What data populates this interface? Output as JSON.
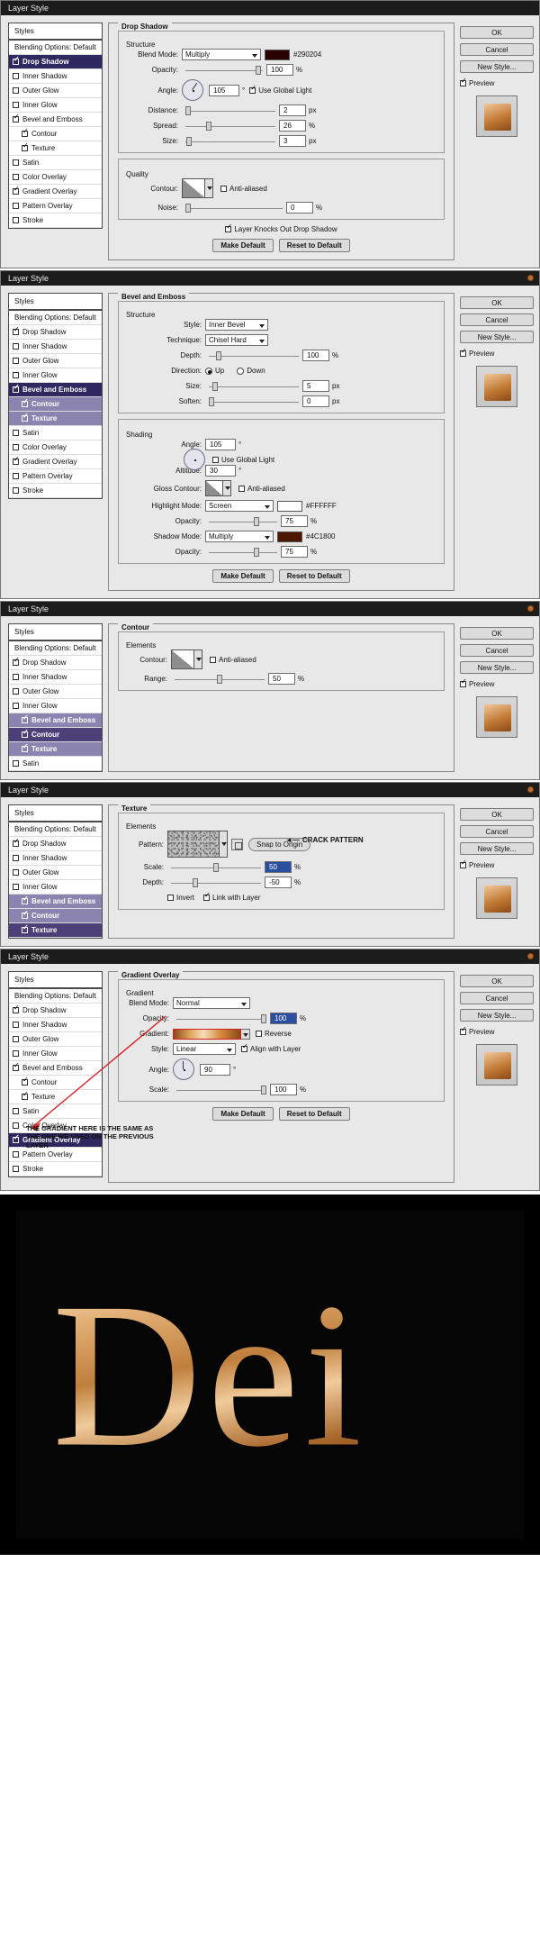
{
  "window_title": "Layer Style",
  "common": {
    "styles_header": "Styles",
    "blending_options": "Blending Options: Default",
    "effects": [
      {
        "label": "Drop Shadow",
        "checked": true
      },
      {
        "label": "Inner Shadow",
        "checked": false
      },
      {
        "label": "Outer Glow",
        "checked": false
      },
      {
        "label": "Inner Glow",
        "checked": false
      },
      {
        "label": "Bevel and Emboss",
        "checked": true
      },
      {
        "label": "Contour",
        "checked": true,
        "sub": true
      },
      {
        "label": "Texture",
        "checked": true,
        "sub": true
      },
      {
        "label": "Satin",
        "checked": false
      },
      {
        "label": "Color Overlay",
        "checked": false
      },
      {
        "label": "Gradient Overlay",
        "checked": true
      },
      {
        "label": "Pattern Overlay",
        "checked": false
      },
      {
        "label": "Stroke",
        "checked": false
      }
    ],
    "buttons": {
      "ok": "OK",
      "cancel": "Cancel",
      "new_style": "New Style...",
      "preview": "Preview"
    },
    "make_default": "Make Default",
    "reset_to_default": "Reset to Default"
  },
  "dialog1": {
    "title": "Layer Style",
    "section": "Drop Shadow",
    "structure_label": "Structure",
    "quality_label": "Quality",
    "blend_mode_label": "Blend Mode:",
    "blend_mode_value": "Multiply",
    "blend_color": "#290204",
    "blend_color_hex": "#290204",
    "opacity_label": "Opacity:",
    "opacity_value": "100",
    "opacity_unit": "%",
    "angle_label": "Angle:",
    "angle_value": "105",
    "angle_unit": "°",
    "use_global_light": "Use Global Light",
    "use_global_light_checked": true,
    "distance_label": "Distance:",
    "distance_value": "2",
    "distance_unit": "px",
    "spread_label": "Spread:",
    "spread_value": "26",
    "spread_unit": "%",
    "size_label": "Size:",
    "size_value": "3",
    "size_unit": "px",
    "contour_label": "Contour:",
    "anti_aliased": "Anti-aliased",
    "noise_label": "Noise:",
    "noise_value": "0",
    "noise_unit": "%",
    "knockout_label": "Layer Knocks Out Drop Shadow",
    "selected_effect": "Drop Shadow"
  },
  "dialog2": {
    "title": "Layer Style",
    "section": "Bevel and Emboss",
    "structure_label": "Structure",
    "shading_label": "Shading",
    "style_label": "Style:",
    "style_value": "Inner Bevel",
    "technique_label": "Technique:",
    "technique_value": "Chisel Hard",
    "depth_label": "Depth:",
    "depth_value": "100",
    "depth_unit": "%",
    "direction_label": "Direction:",
    "direction_up": "Up",
    "direction_down": "Down",
    "direction_selected": "Up",
    "size_label": "Size:",
    "size_value": "5",
    "size_unit": "px",
    "soften_label": "Soften:",
    "soften_value": "0",
    "soften_unit": "px",
    "angle_label": "Angle:",
    "angle_value": "105",
    "angle_unit": "°",
    "use_global_light": "Use Global Light",
    "use_global_light_checked": false,
    "altitude_label": "Altitude:",
    "altitude_value": "30",
    "altitude_unit": "°",
    "gloss_contour_label": "Gloss Contour:",
    "anti_aliased": "Anti-aliased",
    "highlight_mode_label": "Highlight Mode:",
    "highlight_mode_value": "Screen",
    "highlight_color": "#FFFFFF",
    "highlight_hex": "#FFFFFF",
    "highlight_opacity_label": "Opacity:",
    "highlight_opacity_value": "75",
    "shadow_mode_label": "Shadow Mode:",
    "shadow_mode_value": "Multiply",
    "shadow_color": "#4C1800",
    "shadow_hex": "#4C1800",
    "shadow_opacity_label": "Opacity:",
    "shadow_opacity_value": "75",
    "pct": "%",
    "selected_effect": "Bevel and Emboss"
  },
  "dialog3": {
    "title": "Layer Style",
    "section": "Contour",
    "elements_label": "Elements",
    "contour_label": "Contour:",
    "anti_aliased": "Anti-aliased",
    "range_label": "Range:",
    "range_value": "50",
    "range_unit": "%",
    "selected_effect": "Contour"
  },
  "dialog4": {
    "title": "Layer Style",
    "section": "Texture",
    "elements_label": "Elements",
    "pattern_label": "Pattern:",
    "snap_to_origin": "Snap to Origin",
    "scale_label": "Scale:",
    "scale_value": "50",
    "scale_unit": "%",
    "depth_label": "Depth:",
    "depth_value": "-50",
    "depth_unit": "%",
    "invert_label": "Invert",
    "link_with_layer_label": "Link with Layer",
    "link_checked": true,
    "invert_checked": false,
    "annotation": "CRACK PATTERN",
    "selected_effect": "Texture"
  },
  "dialog5": {
    "title": "Layer Style",
    "section": "Gradient Overlay",
    "gradient_label": "Gradient",
    "blend_mode_label": "Blend Mode:",
    "blend_mode_value": "Normal",
    "opacity_label": "Opacity:",
    "opacity_value": "100",
    "opacity_unit": "%",
    "gradient_row_label": "Gradient:",
    "reverse_label": "Reverse",
    "style_label": "Style:",
    "style_value": "Linear",
    "align_with_layer_label": "Align with Layer",
    "align_checked": true,
    "angle_label": "Angle:",
    "angle_value": "90",
    "angle_unit": "°",
    "scale_label": "Scale:",
    "scale_value": "100",
    "scale_unit": "%",
    "annotation": "THE GRADIENT HERE IS THE SAME AS THE ONE WE USED ON THE PREVIOUS LAYER",
    "selected_effect": "Gradient Overlay"
  },
  "artwork": {
    "text": "Dei",
    "background": "#000000"
  }
}
